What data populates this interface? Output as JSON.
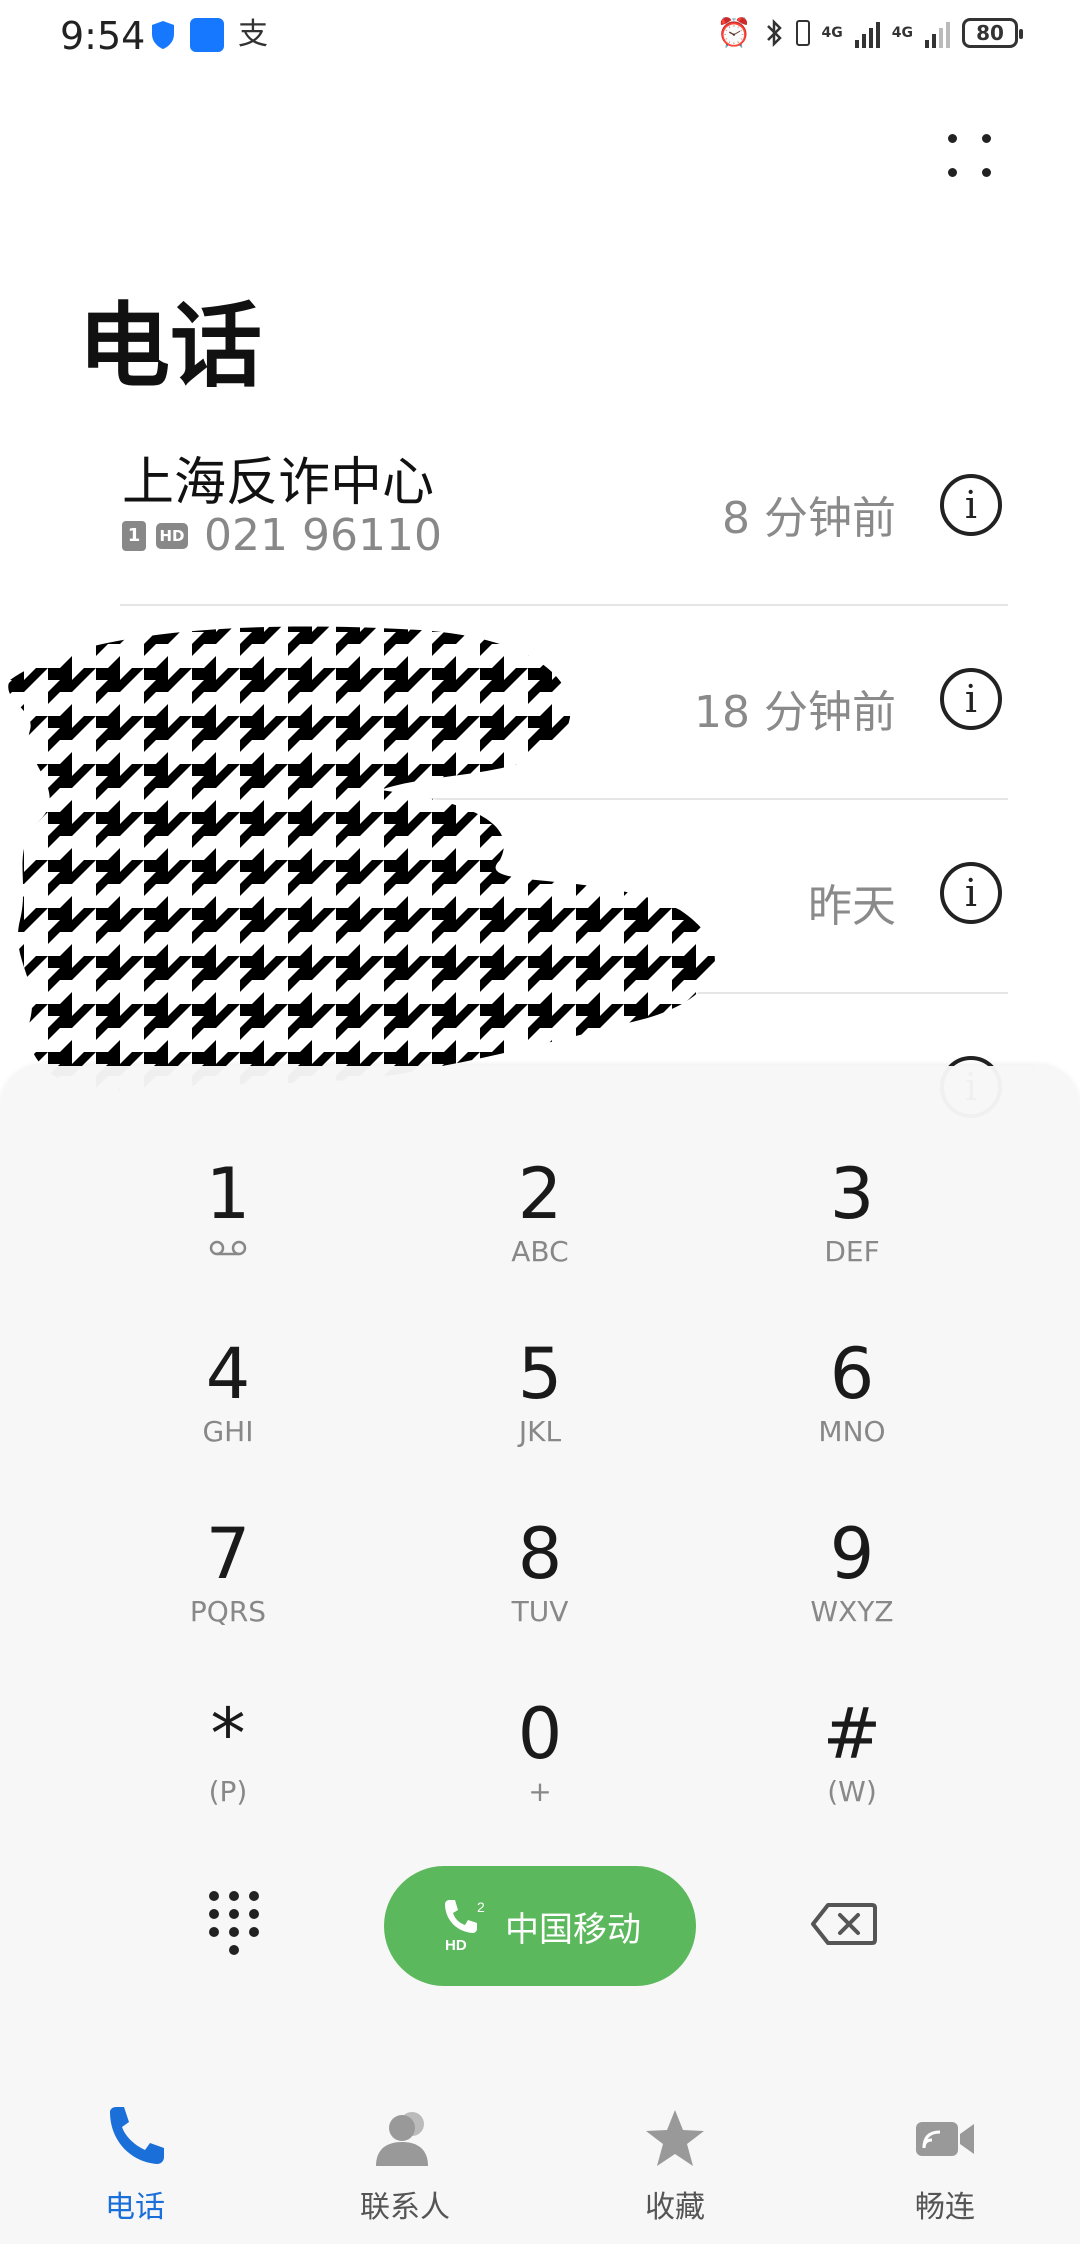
{
  "status_bar": {
    "time": "9:54",
    "app_icon_alipay": "支",
    "battery": "80",
    "network_1": "4G",
    "network_2": "4G"
  },
  "page": {
    "title": "电话"
  },
  "call_log": [
    {
      "name": "上海反诈中心",
      "sim": "1",
      "hd": "HD",
      "number": "021 96110",
      "time": "8 分钟前"
    },
    {
      "name": "",
      "number": "",
      "time": "18 分钟前"
    },
    {
      "name": "",
      "number": "",
      "time": "昨天"
    }
  ],
  "dialpad": {
    "keys": [
      {
        "digit": "1",
        "letters": ""
      },
      {
        "digit": "2",
        "letters": "ABC"
      },
      {
        "digit": "3",
        "letters": "DEF"
      },
      {
        "digit": "4",
        "letters": "GHI"
      },
      {
        "digit": "5",
        "letters": "JKL"
      },
      {
        "digit": "6",
        "letters": "MNO"
      },
      {
        "digit": "7",
        "letters": "PQRS"
      },
      {
        "digit": "8",
        "letters": "TUV"
      },
      {
        "digit": "9",
        "letters": "WXYZ"
      },
      {
        "digit": "*",
        "letters": "(P)"
      },
      {
        "digit": "0",
        "letters": "+"
      },
      {
        "digit": "#",
        "letters": "(W)"
      }
    ],
    "call_label": "中国移动",
    "call_hd": "HD",
    "call_sim": "2"
  },
  "bottom_nav": [
    {
      "label": "电话",
      "icon": "phone-icon",
      "active": true
    },
    {
      "label": "联系人",
      "icon": "contacts-icon",
      "active": false
    },
    {
      "label": "收藏",
      "icon": "star-icon",
      "active": false
    },
    {
      "label": "畅连",
      "icon": "video-icon",
      "active": false
    }
  ],
  "colors": {
    "call_button": "#5cb85c",
    "active_tab": "#1a6fd8"
  }
}
